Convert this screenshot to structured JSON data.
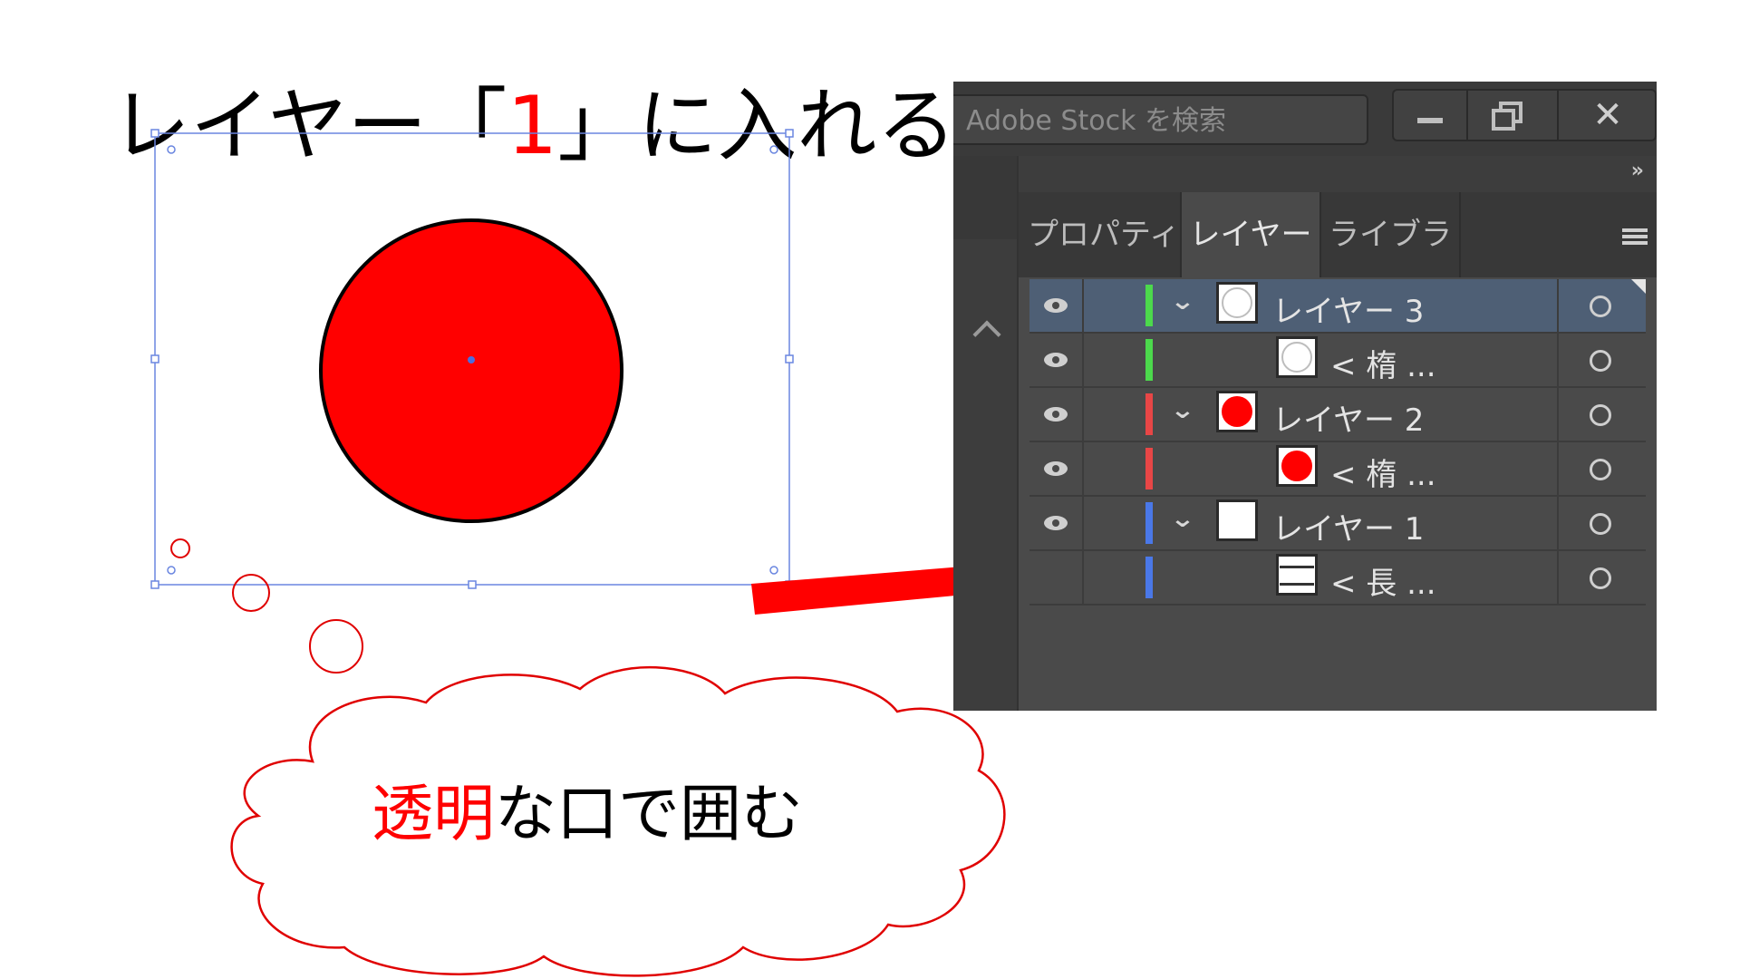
{
  "slide": {
    "title_prefix": "レイヤー「",
    "title_highlight": "1",
    "title_suffix": "」に入れる",
    "cloud_highlight": "透明",
    "cloud_rest": "な口で囲む"
  },
  "colors": {
    "accent": "#ff0000",
    "selection": "#4a6ee0",
    "panel_bg": "#4a4a4a",
    "selected_row": "#4e5f75"
  },
  "panel": {
    "search_placeholder": "Adobe Stock を検索",
    "collapse_icon": "»",
    "close_glyph": "✕",
    "tabs": [
      "プロパティ",
      "レイヤー",
      "ライブラリ"
    ],
    "active_tab": "レイヤー",
    "chevron_glyph": "⌄",
    "rows": [
      {
        "name": "レイヤー 3",
        "color": "#4cd94c",
        "thumb": "white-circle",
        "expanded": true,
        "selected": true
      },
      {
        "name": "< 楕 ...",
        "color": "#4cd94c",
        "thumb": "white-circle",
        "child": true
      },
      {
        "name": "レイヤー 2",
        "color": "#e84646",
        "thumb": "red-circle",
        "expanded": true
      },
      {
        "name": "< 楕 ...",
        "color": "#e84646",
        "thumb": "red-circle",
        "child": true
      },
      {
        "name": "レイヤー 1",
        "color": "#4a78e8",
        "thumb": "white",
        "expanded": true
      },
      {
        "name": "< 長 ...",
        "color": "#4a78e8",
        "thumb": "rect",
        "child": true
      }
    ]
  }
}
